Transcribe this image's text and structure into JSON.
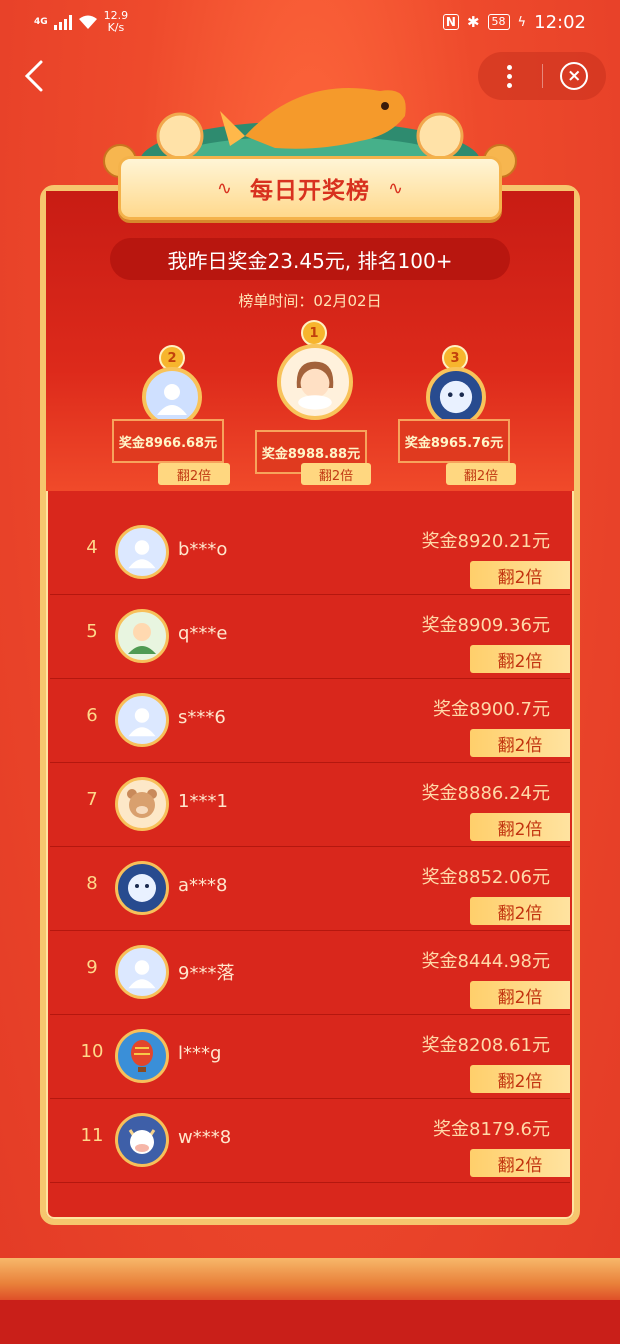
{
  "status_bar": {
    "network": "4G",
    "speed_value": "12.9",
    "speed_unit": "K/s",
    "nfc": "N",
    "bluetooth": "✱",
    "battery": "58",
    "time": "12:02"
  },
  "nav": {
    "back": "‹",
    "close": "×"
  },
  "header": {
    "title": "每日开奖榜",
    "my_summary": "我昨日奖金23.45元, 排名100+",
    "date_line": "榜单时间：02月02日"
  },
  "podium": [
    {
      "rank": "2",
      "prize": "奖金8966.68元",
      "double": "翻2倍",
      "avatar": "default"
    },
    {
      "rank": "1",
      "prize": "奖金8988.88元",
      "double": "翻2倍",
      "avatar": "girl"
    },
    {
      "rank": "3",
      "prize": "奖金8965.76元",
      "double": "翻2倍",
      "avatar": "astronaut"
    }
  ],
  "list": [
    {
      "rank": "4",
      "name": "b***o",
      "prize": "奖金8920.21元",
      "double": "翻2倍",
      "avatar": "default"
    },
    {
      "rank": "5",
      "name": "q***e",
      "prize": "奖金8909.36元",
      "double": "翻2倍",
      "avatar": "cartoon"
    },
    {
      "rank": "6",
      "name": "s***6",
      "prize": "奖金8900.7元",
      "double": "翻2倍",
      "avatar": "default"
    },
    {
      "rank": "7",
      "name": "1***1",
      "prize": "奖金8886.24元",
      "double": "翻2倍",
      "avatar": "bear"
    },
    {
      "rank": "8",
      "name": "a***8",
      "prize": "奖金8852.06元",
      "double": "翻2倍",
      "avatar": "astronaut"
    },
    {
      "rank": "9",
      "name": "9***落",
      "prize": "奖金8444.98元",
      "double": "翻2倍",
      "avatar": "default"
    },
    {
      "rank": "10",
      "name": "l***g",
      "prize": "奖金8208.61元",
      "double": "翻2倍",
      "avatar": "balloon"
    },
    {
      "rank": "11",
      "name": "w***8",
      "prize": "奖金8179.6元",
      "double": "翻2倍",
      "avatar": "ox"
    }
  ],
  "colors": {
    "background": "#e8402a",
    "gold": "#f6c66e",
    "title_red": "#d8311f"
  }
}
